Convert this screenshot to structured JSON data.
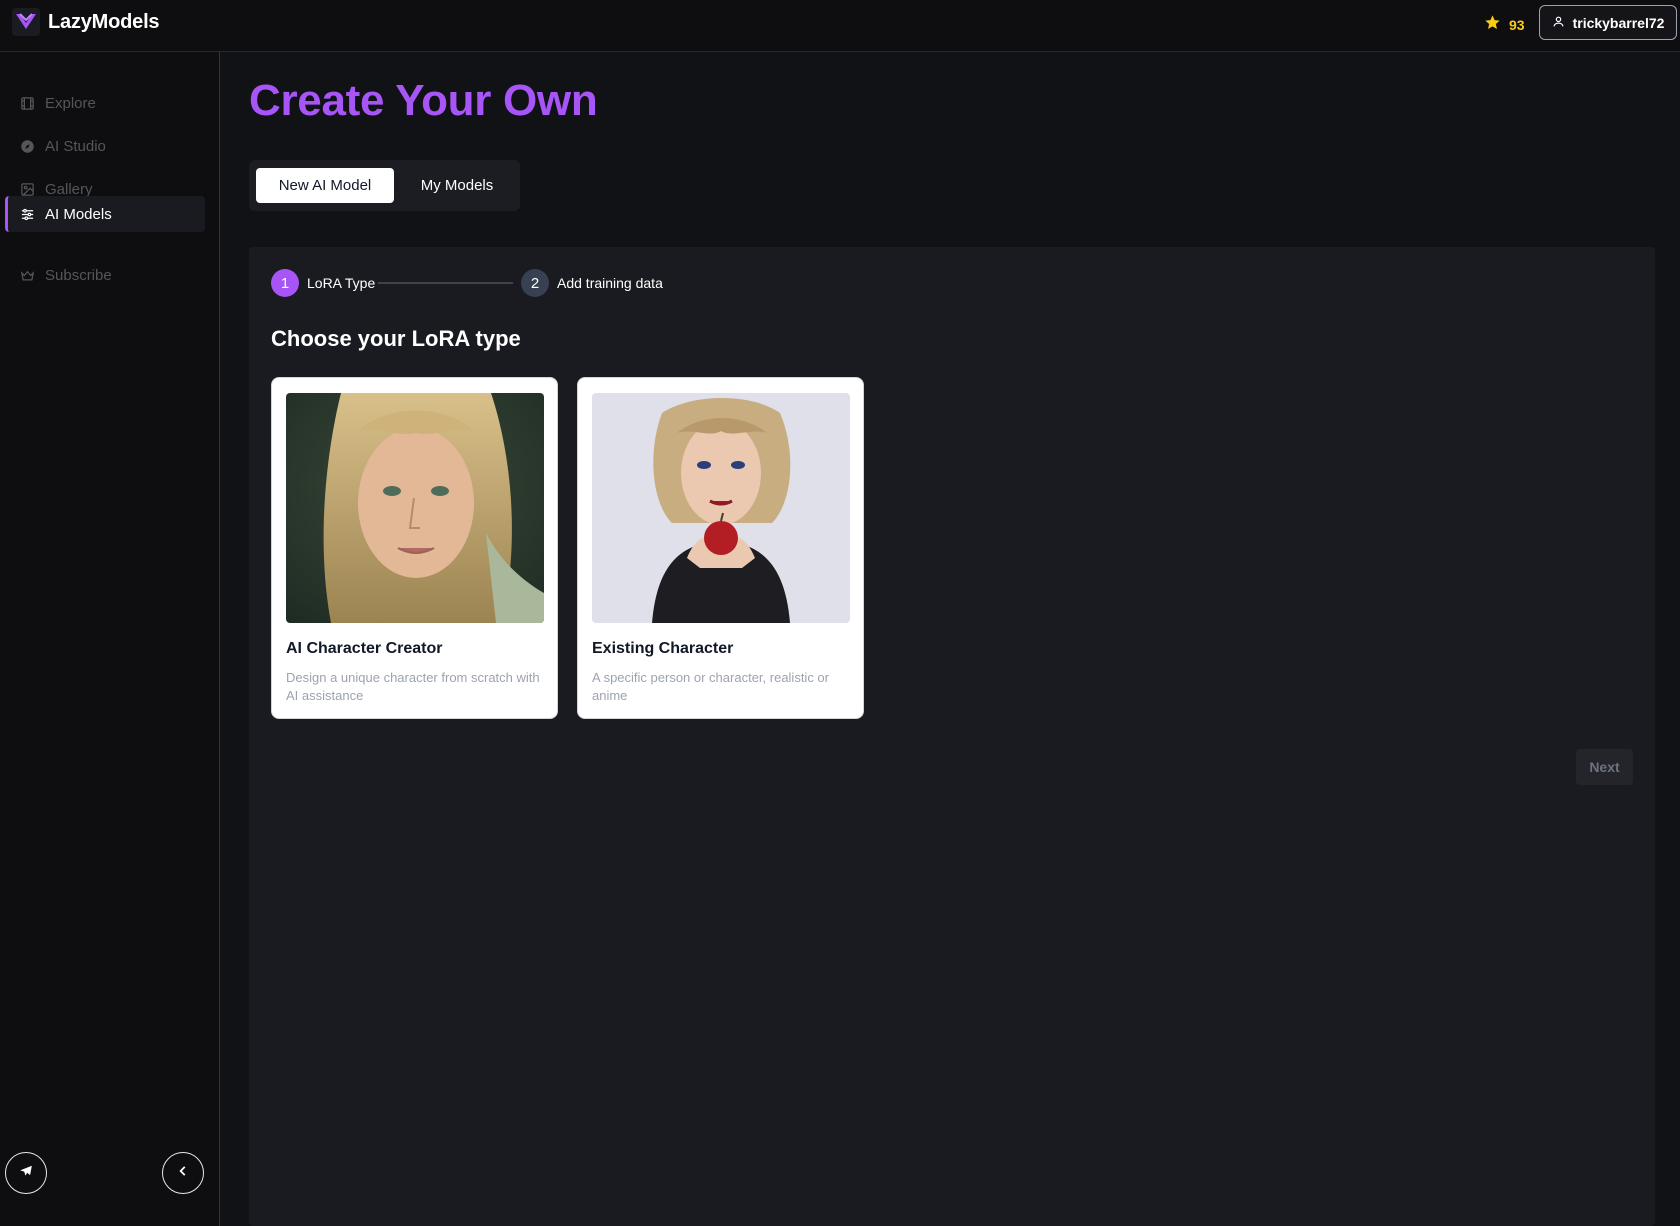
{
  "header": {
    "brand_name": "LazyModels",
    "credits": "93",
    "username": "trickybarrel72"
  },
  "sidebar": {
    "items": [
      {
        "label": "Explore",
        "icon": "film-icon"
      },
      {
        "label": "AI Studio",
        "icon": "compass-icon"
      },
      {
        "label": "Gallery",
        "icon": "image-icon"
      },
      {
        "label": "AI Models",
        "icon": "sliders-icon",
        "active": true
      },
      {
        "label": "Subscribe",
        "icon": "crown-icon"
      }
    ]
  },
  "main": {
    "title": "Create Your Own",
    "tabs": [
      {
        "label": "New AI Model",
        "active": true
      },
      {
        "label": "My Models",
        "active": false
      }
    ],
    "steps": [
      {
        "number": "1",
        "label": "LoRA Type",
        "active": true
      },
      {
        "number": "2",
        "label": "Add training data",
        "active": false
      }
    ],
    "section_title": "Choose your LoRA type",
    "cards": [
      {
        "title": "AI Character Creator",
        "description": "Design a unique character from scratch with AI assistance"
      },
      {
        "title": "Existing Character",
        "description": "A specific person or character, realistic or anime"
      }
    ],
    "next_label": "Next"
  },
  "colors": {
    "accent": "#a855f7",
    "star": "#facc15",
    "background": "#111215",
    "panel": "#1a1b20"
  }
}
